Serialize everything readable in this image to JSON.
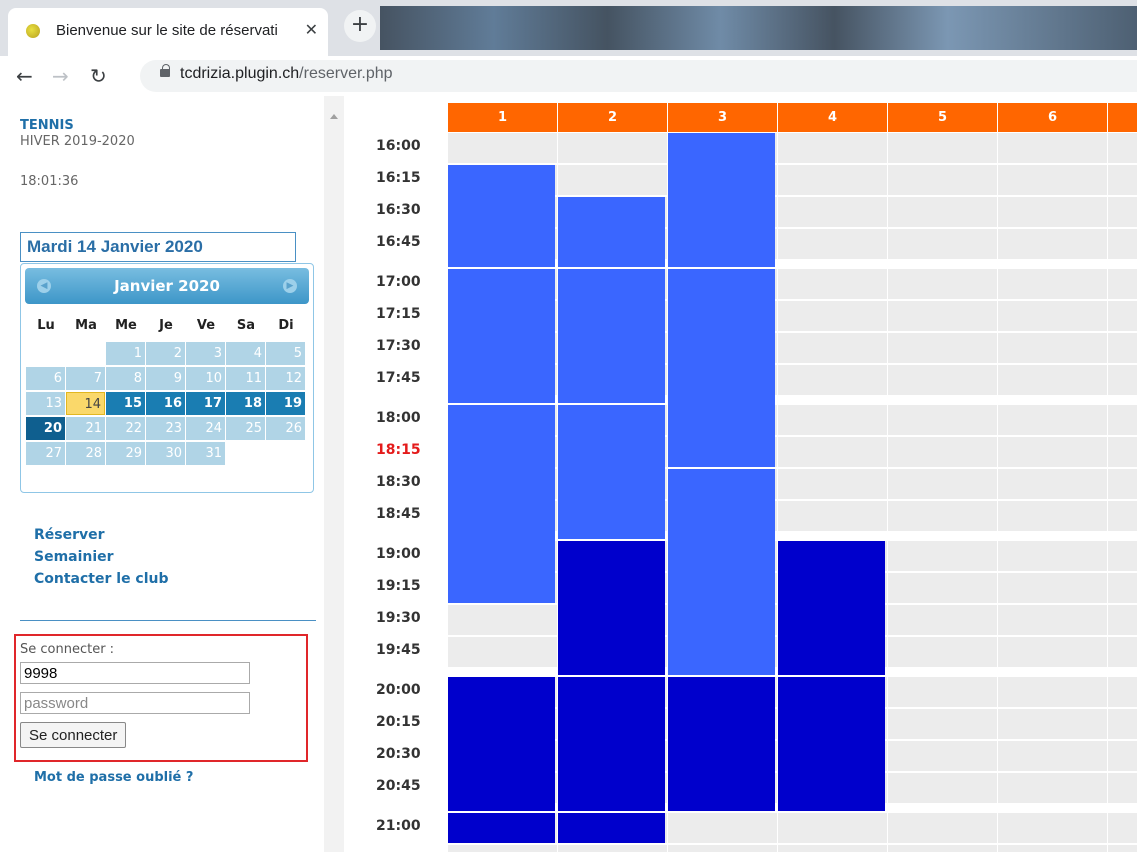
{
  "browser": {
    "tab_title": "Bienvenue sur le site de réservati",
    "url_host": "tcdrizia.plugin.ch",
    "url_path": "/reserver.php"
  },
  "sidebar": {
    "title": "TENNIS",
    "season": "HIVER 2019-2020",
    "clock": "18:01:36",
    "date_field": "Mardi 14 Janvier 2020",
    "calendar": {
      "month": "Janvier 2020",
      "weekdays": [
        "Lu",
        "Ma",
        "Me",
        "Je",
        "Ve",
        "Sa",
        "Di"
      ],
      "days": [
        "1",
        "2",
        "3",
        "4",
        "5",
        "6",
        "7",
        "8",
        "9",
        "10",
        "11",
        "12",
        "13",
        "14",
        "15",
        "16",
        "17",
        "18",
        "19",
        "20",
        "21",
        "22",
        "23",
        "24",
        "25",
        "26",
        "27",
        "28",
        "29",
        "30",
        "31"
      ],
      "today": "14"
    },
    "links": [
      "Réserver",
      "Semainier",
      "Contacter le club"
    ],
    "login": {
      "label": "Se connecter :",
      "user_value": "9998",
      "password_placeholder": "password",
      "button": "Se connecter"
    },
    "forgot": "Mot de passe oublié ?"
  },
  "schedule": {
    "courts": [
      "1",
      "2",
      "3",
      "4",
      "5",
      "6"
    ],
    "times": [
      "16:00",
      "16:15",
      "16:30",
      "16:45",
      "17:00",
      "17:15",
      "17:30",
      "17:45",
      "18:00",
      "18:15",
      "18:30",
      "18:45",
      "19:00",
      "19:15",
      "19:30",
      "19:45",
      "20:00",
      "20:15",
      "20:30",
      "20:45",
      "21:00"
    ],
    "current_time": "18:15",
    "colors": {
      "header": "#ff6600",
      "booked_light": "#3a66ff",
      "booked_dark": "#0000cc",
      "free": "#ececec"
    },
    "bookings": [
      {
        "court": "1",
        "start": "16:15",
        "end": "17:00",
        "kind": "light"
      },
      {
        "court": "2",
        "start": "16:30",
        "end": "17:00",
        "kind": "light"
      },
      {
        "court": "3",
        "start": "16:00",
        "end": "17:00",
        "kind": "light"
      },
      {
        "court": "1",
        "start": "17:00",
        "end": "18:00",
        "kind": "light"
      },
      {
        "court": "2",
        "start": "17:00",
        "end": "18:00",
        "kind": "light"
      },
      {
        "court": "3",
        "start": "17:00",
        "end": "18:30",
        "kind": "light"
      },
      {
        "court": "1",
        "start": "18:00",
        "end": "19:30",
        "kind": "light"
      },
      {
        "court": "2",
        "start": "18:00",
        "end": "19:00",
        "kind": "light"
      },
      {
        "court": "3",
        "start": "18:30",
        "end": "20:00",
        "kind": "light"
      },
      {
        "court": "2",
        "start": "19:00",
        "end": "20:00",
        "kind": "dark"
      },
      {
        "court": "4",
        "start": "19:00",
        "end": "20:00",
        "kind": "dark"
      },
      {
        "court": "1",
        "start": "20:00",
        "end": "21:00",
        "kind": "dark"
      },
      {
        "court": "2",
        "start": "20:00",
        "end": "21:00",
        "kind": "dark"
      },
      {
        "court": "3",
        "start": "20:00",
        "end": "21:00",
        "kind": "dark"
      },
      {
        "court": "4",
        "start": "20:00",
        "end": "21:00",
        "kind": "dark"
      },
      {
        "court": "1",
        "start": "21:00",
        "end": "21:15",
        "kind": "dark"
      },
      {
        "court": "2",
        "start": "21:00",
        "end": "21:15",
        "kind": "dark"
      }
    ]
  }
}
